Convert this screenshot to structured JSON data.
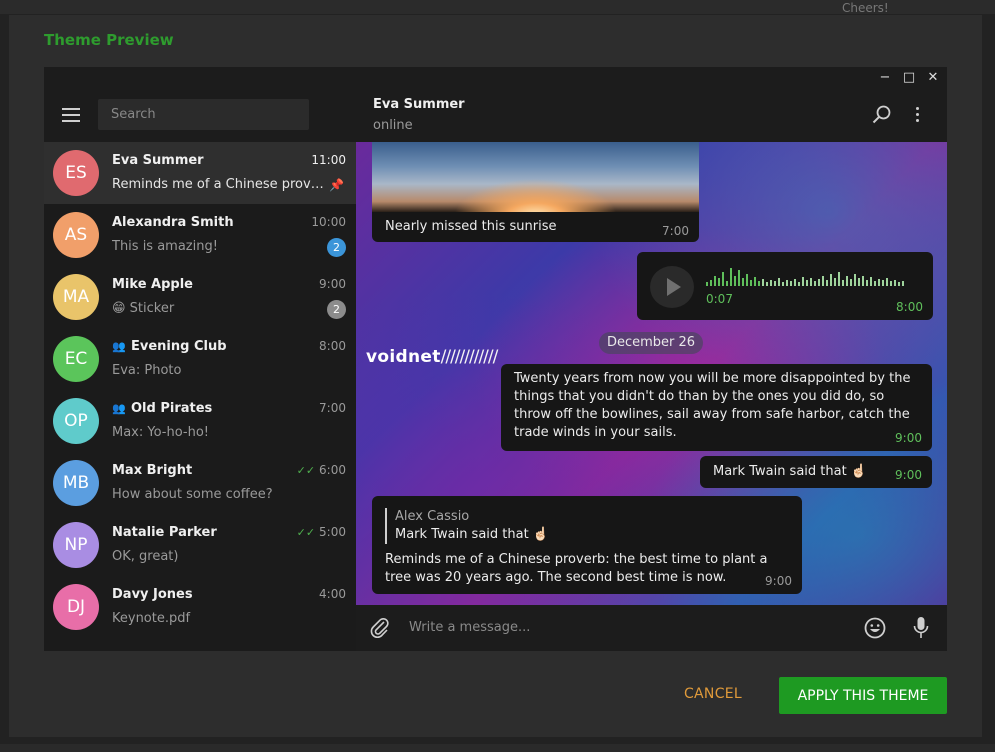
{
  "background": {
    "peek_text": "Cheers!"
  },
  "dialog": {
    "title": "Theme Preview",
    "cancel_label": "CANCEL",
    "apply_label": "APPLY THIS THEME"
  },
  "window_controls": {
    "minimize": "−",
    "maximize": "□",
    "close": "✕"
  },
  "sidebar": {
    "search_placeholder": "Search",
    "chats": [
      {
        "initials": "ES",
        "name": "Eva Summer",
        "time": "11:00",
        "message": "Reminds me of a Chinese proverb: the best time to plant a tree was 20 years ago. The second best time is now.",
        "color": "#e06a6f",
        "active": true,
        "pinned": true
      },
      {
        "initials": "AS",
        "name": "Alexandra Smith",
        "time": "10:00",
        "message": "This is amazing!",
        "color": "#f19f6a",
        "badge": "2",
        "badge_color": "#3b95d9"
      },
      {
        "initials": "MA",
        "name": "Mike Apple",
        "time": "9:00",
        "message": "😁 Sticker",
        "color": "#e9c46a",
        "badge": "2",
        "badge_color": "#8c8c8c"
      },
      {
        "initials": "EC",
        "name": "Evening Club",
        "time": "8:00",
        "message": "Eva: Photo",
        "color": "#5bc55b",
        "group": true
      },
      {
        "initials": "OP",
        "name": "Old Pirates",
        "time": "7:00",
        "message": "Max: Yo-ho-ho!",
        "color": "#5fcbcb",
        "group": true
      },
      {
        "initials": "MB",
        "name": "Max Bright",
        "time": "6:00",
        "message": "How about some coffee?",
        "color": "#5b9ee0",
        "read": true
      },
      {
        "initials": "NP",
        "name": "Natalie Parker",
        "time": "5:00",
        "message": "OK, great)",
        "color": "#a98de3",
        "read": true
      },
      {
        "initials": "DJ",
        "name": "Davy Jones",
        "time": "4:00",
        "message": "Keynote.pdf",
        "color": "#e86ea8"
      }
    ]
  },
  "chat": {
    "name": "Eva Summer",
    "status": "online",
    "wallpaper_text": "voidnet",
    "wallpaper_slashes": "////////////",
    "photo_caption": "Nearly missed this sunrise",
    "photo_time": "7:00",
    "voice_duration": "0:07",
    "voice_time": "8:00",
    "date_divider": "December 26",
    "msg1": "Twenty years from now you will be more disappointed by the things that you didn't do than by the ones you did do, so throw off the bowlines, sail away from safe harbor, catch the trade winds in your sails.",
    "msg1_time": "9:00",
    "msg2": "Mark Twain said that ☝🏻",
    "msg2_time": "9:00",
    "reply_author": "Alex Cassio",
    "reply_text": "Mark Twain said that ☝🏻",
    "msg3": "Reminds me of a Chinese proverb: the best time to plant a tree was 20 years ago. The second best time is now.",
    "msg3_time": "9:00",
    "composer_placeholder": "Write a message..."
  },
  "colors": {
    "accent_green": "#1e9a22",
    "title_green": "#2e9c2e",
    "cancel_orange": "#e09a3a"
  }
}
